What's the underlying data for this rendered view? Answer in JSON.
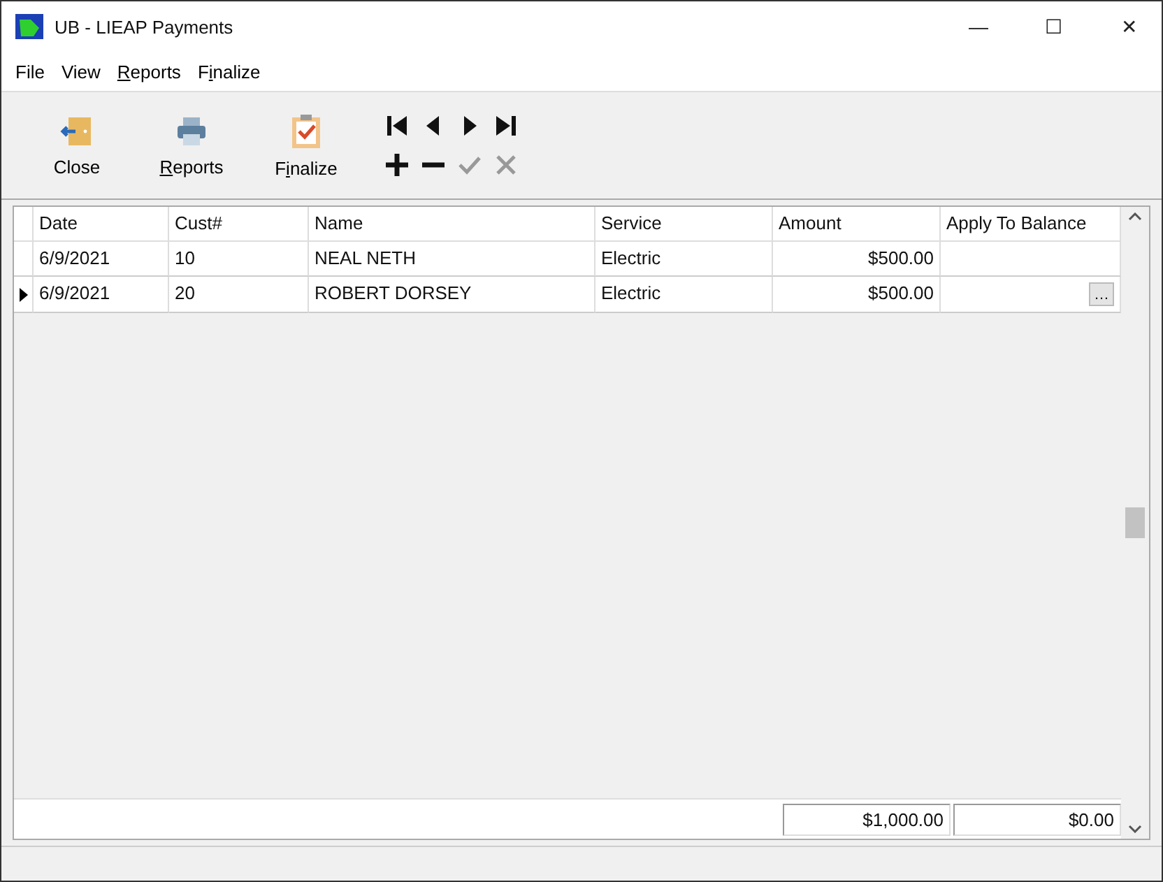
{
  "window": {
    "title": "UB - LIEAP Payments",
    "controls": [
      "—",
      "☐",
      "✕"
    ]
  },
  "menu": [
    {
      "label": "File"
    },
    {
      "label": "View"
    },
    {
      "key": "R",
      "post": "eports"
    },
    {
      "pre": "F",
      "key": "i",
      "post": "nalize"
    }
  ],
  "toolbar": {
    "buttons": [
      {
        "kind": "close",
        "label": "Close"
      },
      {
        "kind": "reports",
        "key": "R",
        "post": "eports"
      },
      {
        "kind": "finalize",
        "pre": "F",
        "key": "i",
        "post": "nalize"
      }
    ],
    "nav": [
      {
        "kind": "first",
        "disabled": false
      },
      {
        "kind": "prev",
        "disabled": false
      },
      {
        "kind": "next",
        "disabled": false
      },
      {
        "kind": "last",
        "disabled": false
      },
      {
        "kind": "add",
        "disabled": false
      },
      {
        "kind": "remove",
        "disabled": false
      },
      {
        "kind": "accept",
        "disabled": true
      },
      {
        "kind": "cancel",
        "disabled": true
      }
    ]
  },
  "table": {
    "columns": [
      "Date",
      "Cust#",
      "Name",
      "Service",
      "Amount",
      "Apply To Balance"
    ],
    "rows": [
      {
        "selected": false,
        "cells": [
          "6/9/2021",
          "10",
          "NEAL NETH",
          "Electric",
          "$500.00",
          null
        ]
      },
      {
        "selected": true,
        "cells": [
          "6/9/2021",
          "20",
          "ROBERT DORSEY",
          "Electric",
          "$500.00",
          "…"
        ]
      }
    ],
    "totals": [
      "$1,000.00",
      "$0.00"
    ]
  }
}
